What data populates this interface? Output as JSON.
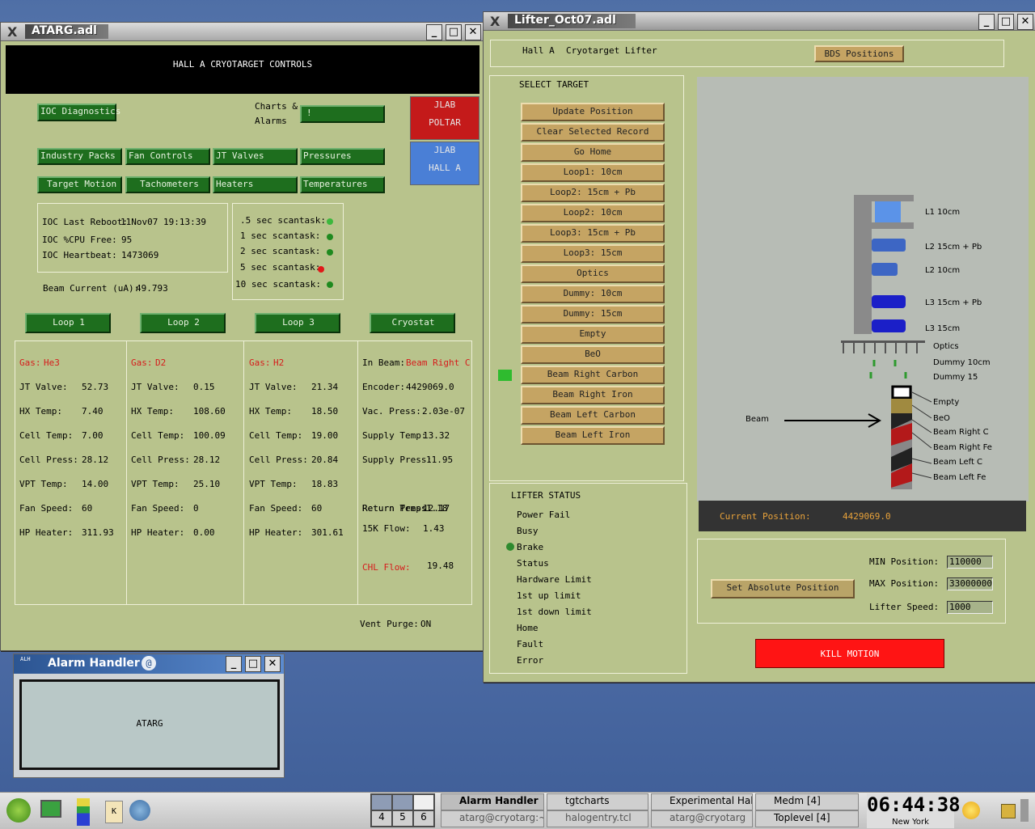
{
  "atarg": {
    "title": "ATARG.adl",
    "header": "HALL A CRYOTARGET CONTROLS",
    "ioc_diag": "IOC Diagnostics",
    "charts_label1": "Charts &",
    "charts_label2": "Alarms",
    "charts_btn": "!",
    "jlab_poltar1": "JLAB",
    "jlab_poltar2": "POLTAR",
    "jlab_halla1": "JLAB",
    "jlab_halla2": "HALL A",
    "menu": [
      "Industry Packs",
      "Fan Controls",
      "JT Valves",
      "Pressures",
      "Target Motion",
      "Tachometers",
      "Heaters",
      "Temperatures"
    ],
    "ioc": {
      "reboot_label": "IOC Last Reboot:",
      "reboot_value": "11Nov07 19:13:39",
      "cpu_label": "IOC %CPU Free:",
      "cpu_value": "95",
      "heartbeat_label": "IOC Heartbeat:",
      "heartbeat_value": "1473069"
    },
    "scantasks": [
      {
        "label": ".5 sec scantask:",
        "color": "#3db83d"
      },
      {
        "label": "1 sec scantask:",
        "color": "#1f8a1f"
      },
      {
        "label": "2 sec scantask:",
        "color": "#1f8a1f"
      },
      {
        "label": "5 sec scantask:",
        "color": "#e01818"
      },
      {
        "label": "10 sec scantask:",
        "color": "#1f8a1f"
      }
    ],
    "beam_current_label": "Beam Current (uA):",
    "beam_current_value": "49.793",
    "loops": [
      "Loop 1",
      "Loop 2",
      "Loop 3",
      "Cryostat"
    ],
    "gas_label": "Gas:",
    "gases": [
      "He3",
      "D2",
      "H2"
    ],
    "row_labels": [
      "JT Valve:",
      "HX Temp:",
      "Cell Temp:",
      "Cell Press:",
      "VPT Temp:",
      "Fan Speed:",
      "HP Heater:"
    ],
    "loop_values": [
      [
        "52.73",
        "7.40",
        "7.00",
        "28.12",
        "14.00",
        "60",
        "311.93"
      ],
      [
        "0.15",
        "108.60",
        "100.09",
        "28.12",
        "25.10",
        "0",
        "0.00"
      ],
      [
        "21.34",
        "18.50",
        "19.00",
        "20.84",
        "18.83",
        "60",
        "301.61"
      ]
    ],
    "cryostat": {
      "inbeam_label": "In Beam:",
      "inbeam_value": "Beam Right C",
      "rows": [
        {
          "label": "Encoder:",
          "value": "4429069.0"
        },
        {
          "label": "Vac. Press:",
          "value": "2.03e-07"
        },
        {
          "label": "Supply Temp:",
          "value": "13.32"
        },
        {
          "label": "Supply Press:",
          "value": "11.95"
        },
        {
          "label": "Return Temp:",
          "value": "12.17"
        },
        {
          "label": "Return Press:",
          "value": "1.18"
        },
        {
          "label": "15K Flow:",
          "value": "1.43"
        }
      ],
      "chl_label": "CHL Flow:",
      "chl_value": "19.48",
      "vent_label": "Vent Purge:",
      "vent_value": "ON"
    }
  },
  "lifter": {
    "title": "Lifter_Oct07.adl",
    "hall": "Hall A",
    "subtitle": "Cryotarget Lifter",
    "bds": "BDS Positions",
    "select_target": "SELECT TARGET",
    "targets": [
      "Update Position",
      "Clear Selected Record",
      "Go Home",
      "Loop1: 10cm",
      "Loop2: 15cm + Pb",
      "Loop2: 10cm",
      "Loop3: 15cm + Pb",
      "Loop3: 15cm",
      "Optics",
      "Dummy: 10cm",
      "Dummy: 15cm",
      "Empty",
      "BeO",
      "Beam Right Carbon",
      "Beam Right Iron",
      "Beam Left Carbon",
      "Beam Left Iron"
    ],
    "status_title": "LIFTER STATUS",
    "status": [
      "Power Fail",
      "Busy",
      "Brake",
      "Status",
      "Hardware Limit",
      "1st up limit",
      "1st down limit",
      "Home",
      "Fault",
      "Error"
    ],
    "diagram_labels": [
      "L1 10cm",
      "L2 15cm + Pb",
      "L2 10cm",
      "L3 15cm + Pb",
      "L3 15cm",
      "Optics",
      "Dummy 10cm",
      "Dummy 15",
      "Empty",
      "BeO",
      "Beam Right C",
      "Beam Right Fe",
      "Beam Left C",
      "Beam Left Fe"
    ],
    "beam_label": "Beam",
    "current_label": "Current Position:",
    "current_value": "4429069.0",
    "set_abs": "Set Absolute Position",
    "min_label": "MIN Position:",
    "min_value": "110000",
    "max_label": "MAX Position:",
    "max_value": "33000000",
    "speed_label": "Lifter Speed:",
    "speed_value": "1000",
    "kill": "KILL MOTION"
  },
  "alarm": {
    "title": "Alarm Handler",
    "btn": "ATARG"
  },
  "taskbar": {
    "desktops": [
      "4",
      "5",
      "6"
    ],
    "tasks": [
      {
        "top": "Alarm Handler",
        "bottom": "atarg@cryotarg:~"
      },
      {
        "top": "tgtcharts",
        "bottom": "halogentry.tcl"
      },
      {
        "top": "Experimental Hall",
        "bottom": "atarg@cryotarg"
      },
      {
        "top": "Medm [4]",
        "bottom": "Toplevel [4]"
      }
    ],
    "clock": "06:44:38",
    "city": "New York"
  }
}
